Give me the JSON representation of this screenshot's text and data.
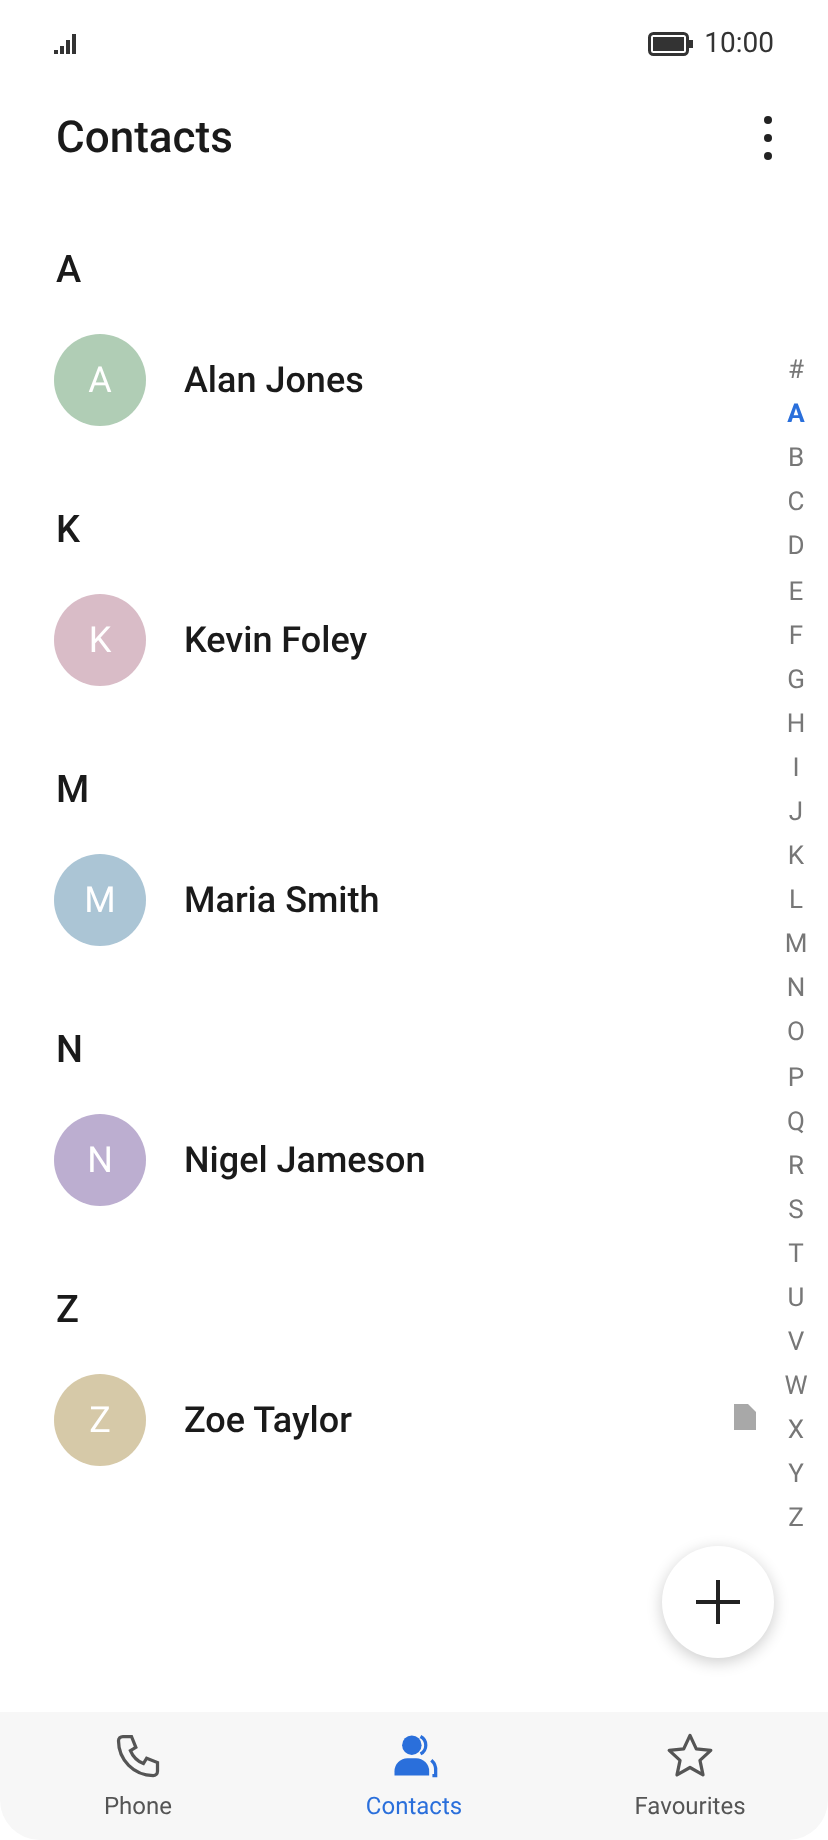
{
  "status_bar": {
    "time": "10:00"
  },
  "header": {
    "title": "Contacts"
  },
  "sections": [
    {
      "letter": "A",
      "contacts": [
        {
          "initial": "A",
          "name": "Alan Jones",
          "color": "#b0cdb5"
        }
      ]
    },
    {
      "letter": "K",
      "contacts": [
        {
          "initial": "K",
          "name": "Kevin Foley",
          "color": "#d9bcc7"
        }
      ]
    },
    {
      "letter": "M",
      "contacts": [
        {
          "initial": "M",
          "name": "Maria Smith",
          "color": "#abc5d5"
        }
      ]
    },
    {
      "letter": "N",
      "contacts": [
        {
          "initial": "N",
          "name": "Nigel Jameson",
          "color": "#bcaed0"
        }
      ]
    },
    {
      "letter": "Z",
      "contacts": [
        {
          "initial": "Z",
          "name": "Zoe Taylor",
          "color": "#d6c9a8"
        }
      ]
    }
  ],
  "index": [
    {
      "label": "#",
      "selected": false
    },
    {
      "label": "A",
      "selected": true
    },
    {
      "label": "B",
      "selected": false
    },
    {
      "label": "C",
      "selected": false
    },
    {
      "label": "D",
      "selected": false
    },
    {
      "label": "E",
      "selected": false
    },
    {
      "label": "F",
      "selected": false
    },
    {
      "label": "G",
      "selected": false
    },
    {
      "label": "H",
      "selected": false
    },
    {
      "label": "I",
      "selected": false
    },
    {
      "label": "J",
      "selected": false
    },
    {
      "label": "K",
      "selected": false
    },
    {
      "label": "L",
      "selected": false
    },
    {
      "label": "M",
      "selected": false
    },
    {
      "label": "N",
      "selected": false
    },
    {
      "label": "O",
      "selected": false
    },
    {
      "label": "P",
      "selected": false
    },
    {
      "label": "Q",
      "selected": false
    },
    {
      "label": "R",
      "selected": false
    },
    {
      "label": "S",
      "selected": false
    },
    {
      "label": "T",
      "selected": false
    },
    {
      "label": "U",
      "selected": false
    },
    {
      "label": "V",
      "selected": false
    },
    {
      "label": "W",
      "selected": false
    },
    {
      "label": "X",
      "selected": false
    },
    {
      "label": "Y",
      "selected": false
    },
    {
      "label": "Z",
      "selected": false
    }
  ],
  "bottom_nav": [
    {
      "label": "Phone",
      "kind": "phone",
      "selected": false
    },
    {
      "label": "Contacts",
      "kind": "contacts",
      "selected": true
    },
    {
      "label": "Favourites",
      "kind": "star",
      "selected": false
    }
  ]
}
